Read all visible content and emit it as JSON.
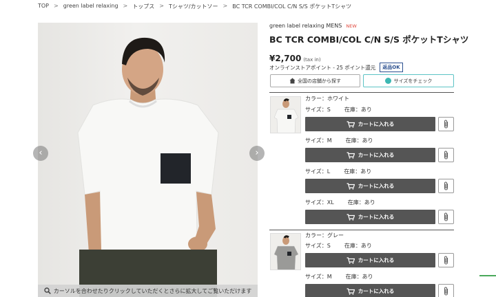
{
  "breadcrumb": [
    "TOP",
    "green label relaxing",
    "トップス",
    "Tシャツ/カットソー",
    "BC TCR COMBI/COL C/N S/S ポケットTシャツ"
  ],
  "gallery": {
    "zoom_hint": "カーソルを合わせたりクリックしていただくとさらに拡大してご覧いただけます",
    "prev_icon": "chevron-left-icon",
    "next_icon": "chevron-right-icon"
  },
  "product": {
    "brand": "green label relaxing MENS",
    "new_badge": "NEW",
    "title": "BC TCR COMBI/COL C/N S/S ポケットTシャツ",
    "price": "¥2,700",
    "tax": "(tax in)",
    "points": "オンラインストアポイント - 25 ポイント還元",
    "return_badge": "返品OK",
    "store_button": "全国の店舗から探す",
    "size_check_button": "サイズをチェック"
  },
  "colors": [
    {
      "label": "カラー：ホワイト",
      "shirt_color": "#f7f7f5",
      "sizes": [
        {
          "size": "サイズ：S",
          "stock": "在庫：あり"
        },
        {
          "size": "サイズ：M",
          "stock": "在庫：あり"
        },
        {
          "size": "サイズ：L",
          "stock": "在庫：あり"
        },
        {
          "size": "サイズ：XL",
          "stock": "在庫：あり"
        }
      ]
    },
    {
      "label": "カラー：グレー",
      "shirt_color": "#9a9a98",
      "sizes": [
        {
          "size": "サイズ：S",
          "stock": "在庫：あり"
        },
        {
          "size": "サイズ：M",
          "stock": "在庫：あり"
        }
      ]
    }
  ],
  "cart_label": "カートに入れる",
  "accent_colors": {
    "cart": "#555555",
    "teal": "#5bc3c5",
    "new": "#e0453a"
  }
}
